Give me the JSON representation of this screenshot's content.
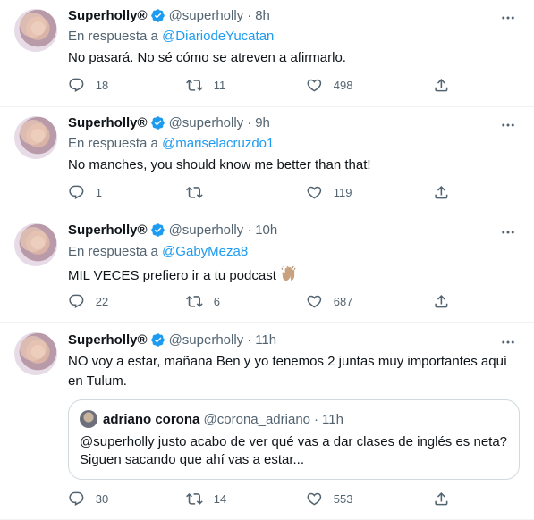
{
  "tweets": [
    {
      "name": "Superholly®",
      "handle": "@superholly",
      "time": "8h",
      "reply_prefix": "En respuesta a",
      "reply_to": "@DiariodeYucatan",
      "text": "No pasará. No sé cómo se atreven a afirmarlo.",
      "replies": "18",
      "retweets": "11",
      "likes": "498"
    },
    {
      "name": "Superholly®",
      "handle": "@superholly",
      "time": "9h",
      "reply_prefix": "En respuesta a",
      "reply_to": "@mariselacruzdo1",
      "text": "No manches, you should know me better than that!",
      "replies": "1",
      "retweets": "",
      "likes": "119"
    },
    {
      "name": "Superholly®",
      "handle": "@superholly",
      "time": "10h",
      "reply_prefix": "En respuesta a",
      "reply_to": "@GabyMeza8",
      "text": "MIL VECES prefiero ir a tu podcast",
      "emoji": "raising-hands",
      "replies": "22",
      "retweets": "6",
      "likes": "687"
    },
    {
      "name": "Superholly®",
      "handle": "@superholly",
      "time": "11h",
      "text_line1": "NO voy a estar, mañana Ben y yo tenemos 2 juntas muy importantes aquí",
      "text_line2": "en Tulum.",
      "quote": {
        "name": "adriano corona",
        "handle": "@corona_adriano",
        "time": "11h",
        "line1": "@superholly justo acabo de ver qué vas a dar clases de inglés es neta?",
        "line2": "Siguen sacando que ahí vas a estar..."
      },
      "replies": "30",
      "retweets": "14",
      "likes": "553"
    }
  ],
  "separator": "·",
  "colors": {
    "accent": "#1d9bf0",
    "secondary_text": "#536471",
    "primary_text": "#0f1419",
    "divider": "#eff3f4"
  },
  "icons": [
    "verified-icon",
    "more-icon",
    "reply-icon",
    "retweet-icon",
    "like-icon",
    "share-icon",
    "raising-hands-icon"
  ]
}
